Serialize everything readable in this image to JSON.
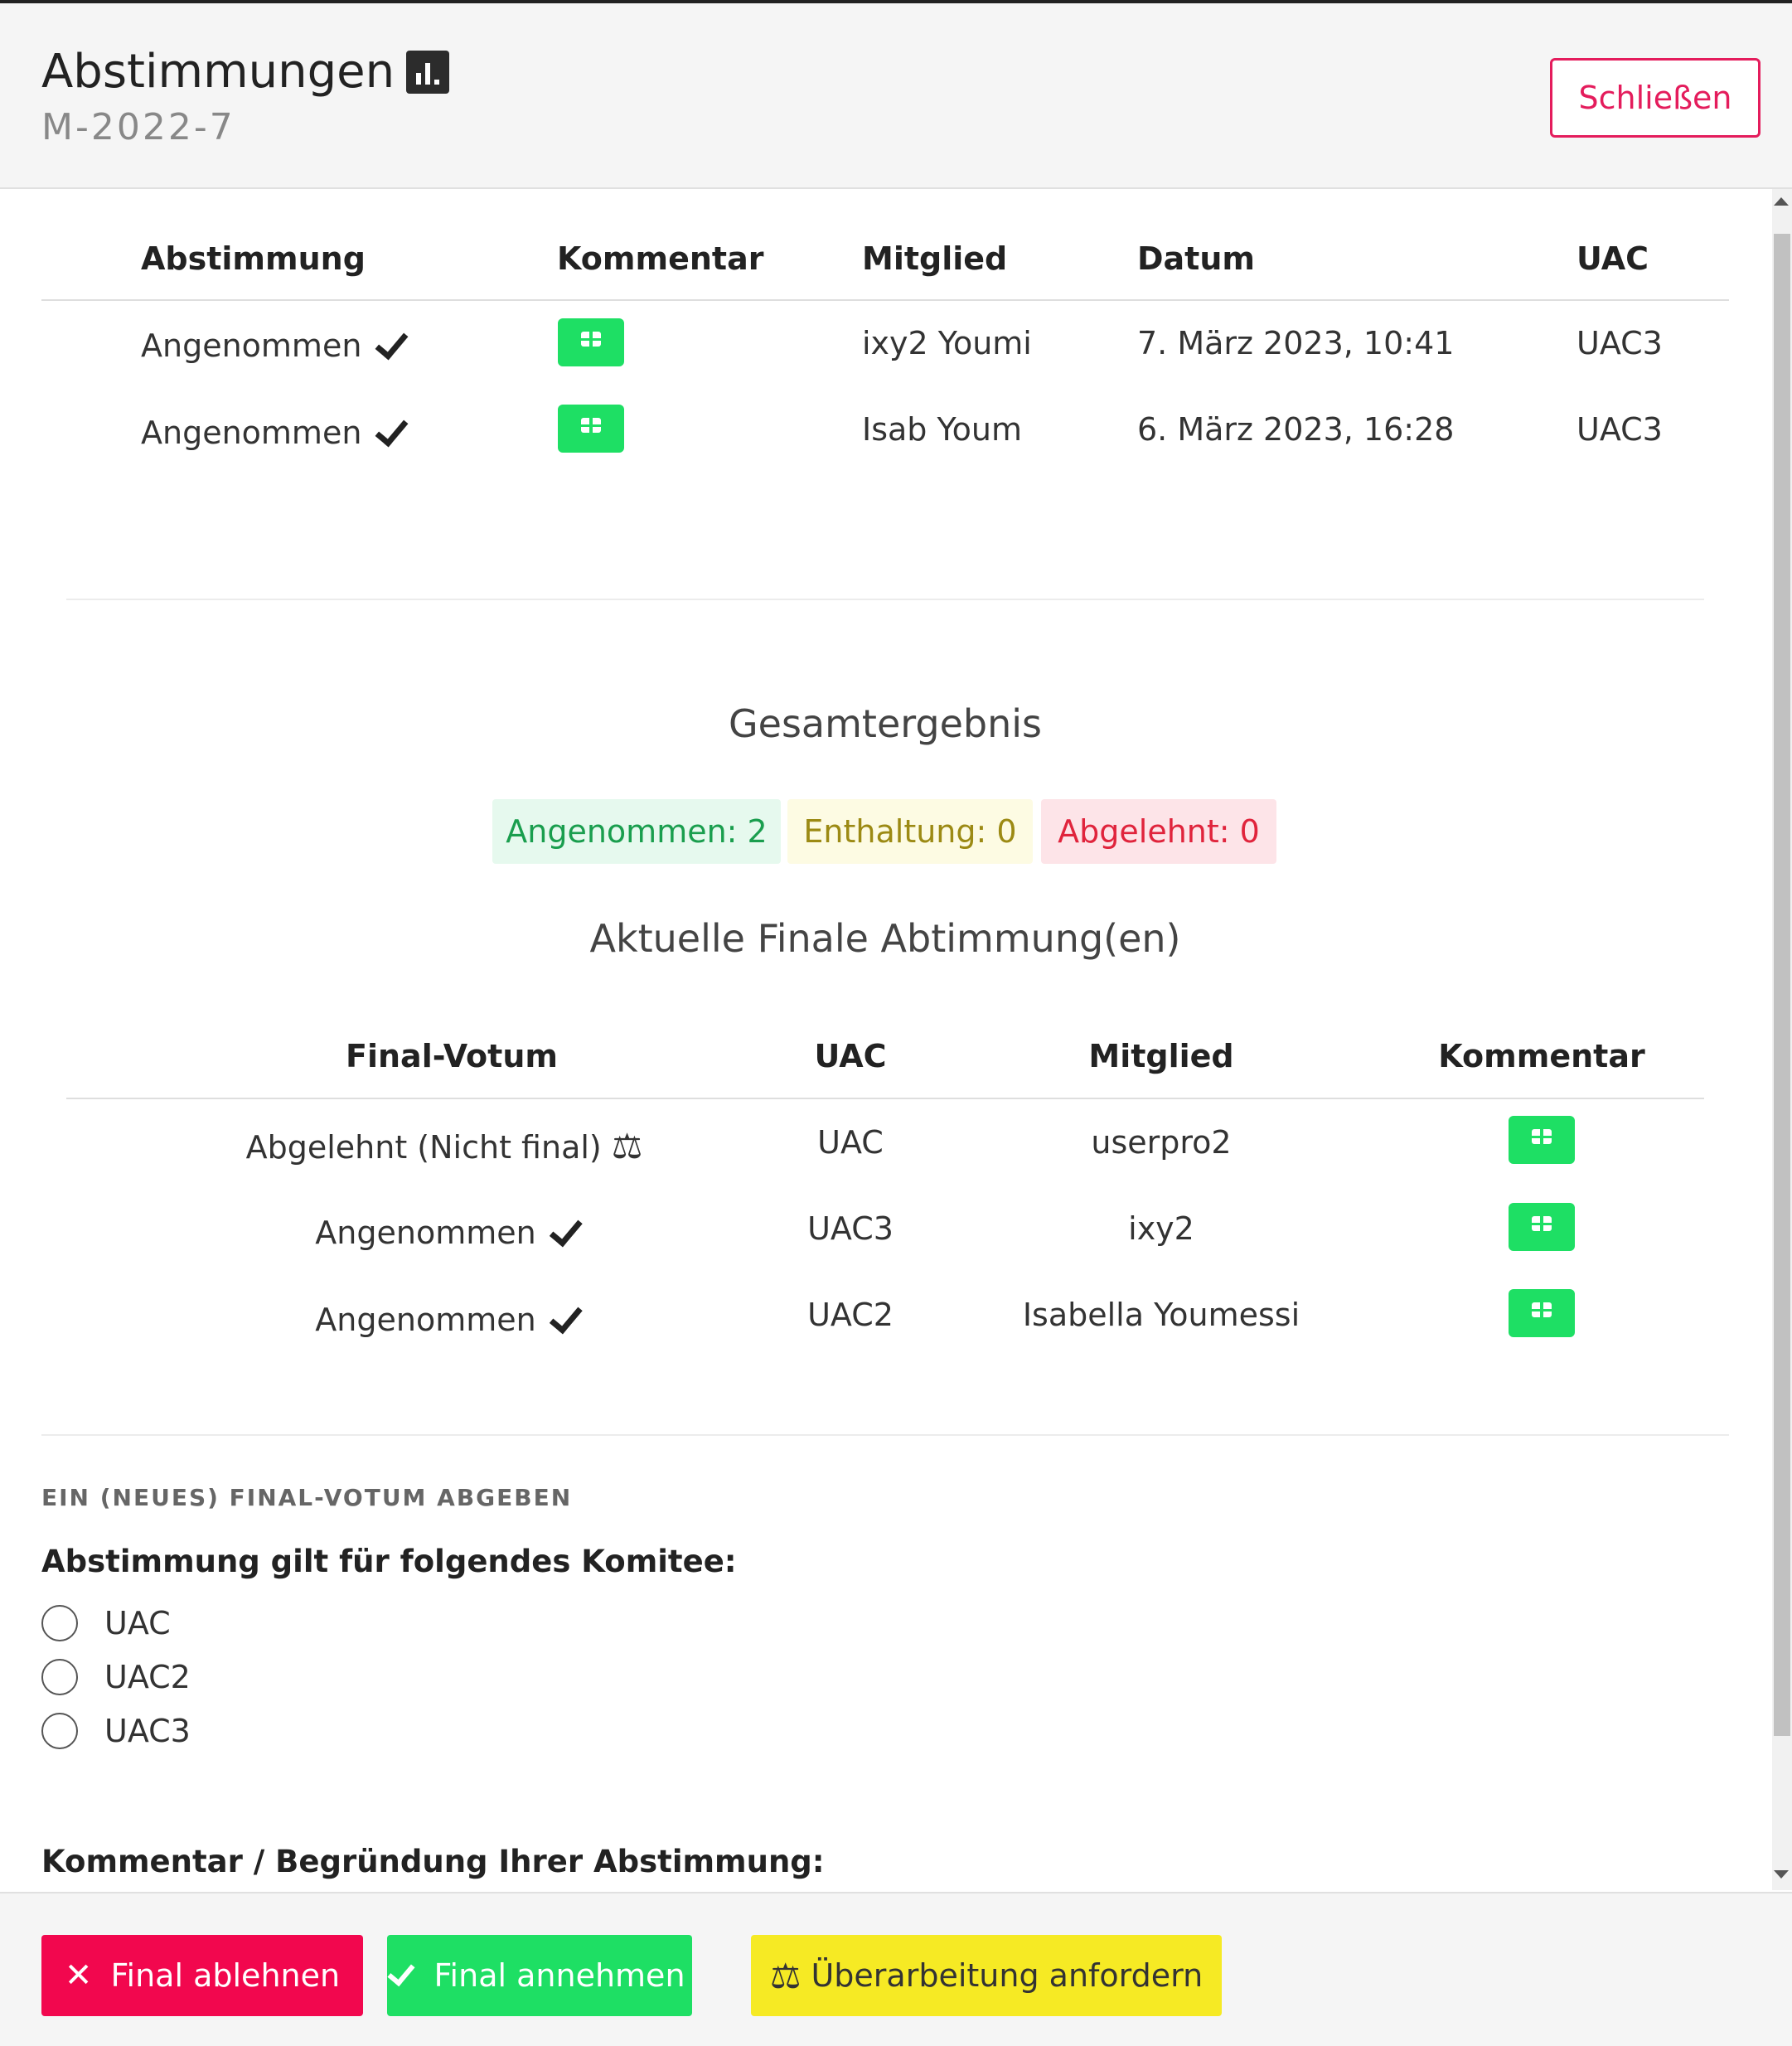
{
  "header": {
    "title": "Abstimmungen",
    "title_icon": "bar-chart-icon",
    "subtitle": "M-2022-7",
    "close_label": "Schließen"
  },
  "votes_table": {
    "headers": [
      "Abstimmung",
      "Kommentar",
      "Mitglied",
      "Datum",
      "UAC"
    ],
    "rows": [
      {
        "vote": "Angenommen",
        "member": "ixy2 Youmi",
        "date": "7. März 2023, 10:41",
        "uac": "UAC3"
      },
      {
        "vote": "Angenommen",
        "member": "Isab Youm",
        "date": "6. März 2023, 16:28",
        "uac": "UAC3"
      }
    ]
  },
  "summary": {
    "title": "Gesamtergebnis",
    "accepted": "Angenommen: 2",
    "abstained": "Enthaltung: 0",
    "rejected": "Abgelehnt: 0",
    "colors": {
      "accepted_bg": "#e6f9ee",
      "accepted_text": "#1a9e4e",
      "abstained_bg": "#fdfbe3",
      "abstained_text": "#9c8a14",
      "rejected_bg": "#fde4e8",
      "rejected_text": "#e0243c"
    }
  },
  "final_votes": {
    "title": "Aktuelle Finale Abtimmung(en)",
    "headers": [
      "Final-Votum",
      "UAC",
      "Mitglied",
      "Kommentar"
    ],
    "rows": [
      {
        "vote": "Abgelehnt (Nicht final)",
        "icon": "scale-icon",
        "uac": "UAC",
        "member": "userpro2"
      },
      {
        "vote": "Angenommen",
        "icon": "check-icon",
        "uac": "UAC3",
        "member": "ixy2"
      },
      {
        "vote": "Angenommen",
        "icon": "check-icon",
        "uac": "UAC2",
        "member": "Isabella Youmessi"
      }
    ]
  },
  "form": {
    "section_label": "EIN (NEUES) FINAL-VOTUM ABGEBEN",
    "committee_label": "Abstimmung gilt für folgendes Komitee:",
    "options": [
      "UAC",
      "UAC2",
      "UAC3"
    ],
    "comment_label": "Kommentar / Begründung Ihrer Abstimmung:"
  },
  "footer": {
    "reject_label": "Final ablehnen",
    "accept_label": "Final annehmen",
    "revise_label": "Überarbeitung anfordern",
    "colors": {
      "reject": "#f2074e",
      "accept": "#1edf64",
      "revise": "#f6ea24"
    }
  }
}
